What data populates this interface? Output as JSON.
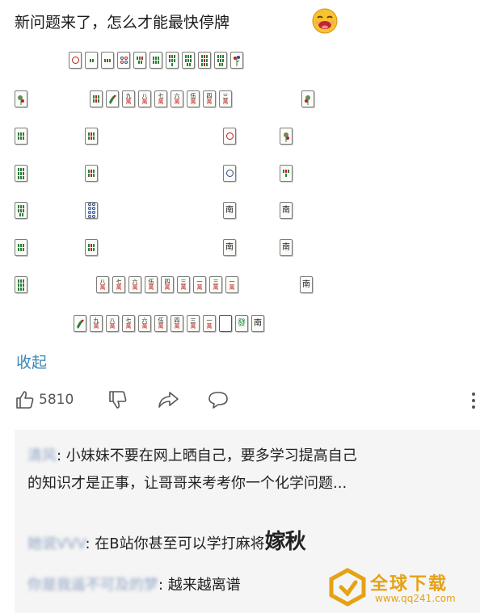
{
  "post": {
    "title": "新问题来了，怎么才能最快停牌",
    "collapse_label": "收起"
  },
  "tiles": {
    "wan": "萬",
    "south": "南",
    "fa": "發",
    "top_row": [
      "1p",
      "2s",
      "3s",
      "4p",
      "5s",
      "6s",
      "7s",
      "8s",
      "flower"
    ],
    "row1": [
      "flower",
      "gap",
      "s",
      "flower",
      "9",
      "8",
      "7",
      "6",
      "5",
      "4",
      "3",
      "gap",
      "flower"
    ],
    "hand_lower": [
      "8",
      "7",
      "6",
      "5",
      "4",
      "3",
      "1",
      "3",
      "1"
    ],
    "hand_bottom": [
      "flower",
      "9",
      "8",
      "7",
      "6",
      "5",
      "4",
      "3",
      "1",
      "blank",
      "發",
      "南"
    ]
  },
  "actions": {
    "like_count": "5810"
  },
  "comments": [
    {
      "user": "清风",
      "sep": ": ",
      "line1": "小妹妹不要在网上晒自己，要多学习提高自己",
      "line2": "的知识才是正事，让哥哥来考考你一个化学问题..."
    },
    {
      "user": "她说VVV",
      "sep": ": ",
      "text": "在B站你甚至可以学打麻将",
      "tail": "嫁秋"
    },
    {
      "user": "你是我遥不可及的梦",
      "sep": ": ",
      "text": "越来越离谱"
    }
  ],
  "watermark": {
    "brand": "全球下载",
    "url": "www.qq241.com"
  },
  "colors": {
    "link": "#3a86b6",
    "tile_red": "#c42020",
    "tile_green": "#2e7d3c",
    "tile_blue": "#2a4a8a",
    "comment_bg": "#f5f5f5",
    "watermark": "#e5a215"
  }
}
